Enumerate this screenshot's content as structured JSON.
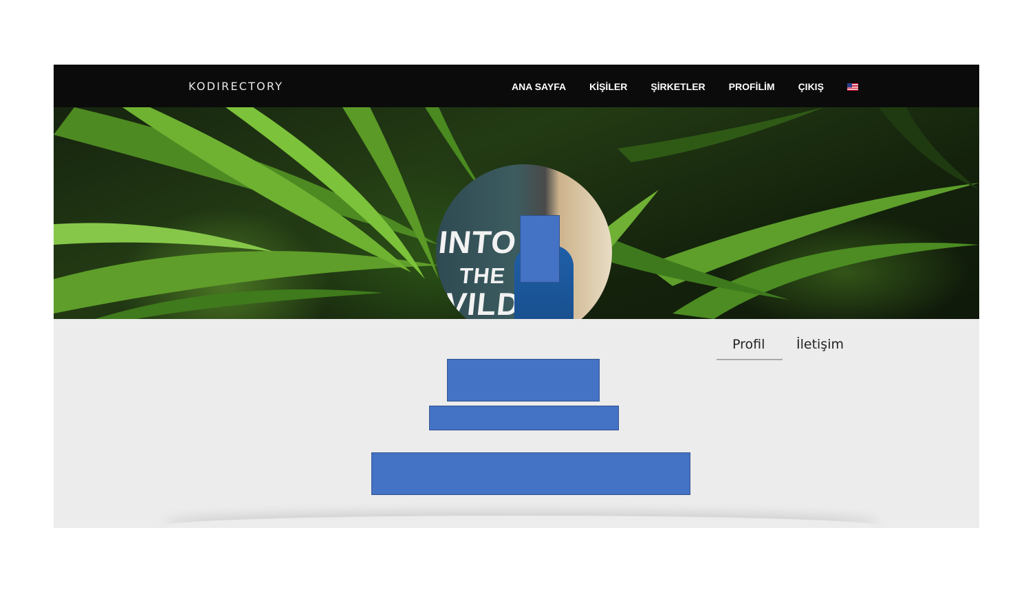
{
  "header": {
    "brand": "KODIRECTORY",
    "nav": [
      {
        "label": "ANA SAYFA"
      },
      {
        "label": "KİŞİLER"
      },
      {
        "label": "ŞİRKETLER"
      },
      {
        "label": "PROFİLİM"
      },
      {
        "label": "ÇIKIŞ"
      }
    ],
    "language_flag": "us-flag-icon"
  },
  "hero": {
    "background": "green plant leaves",
    "avatar": "profile photo"
  },
  "avatar_text": {
    "line1": "INTO",
    "line2": "THE",
    "line3": "VILD"
  },
  "profile": {
    "tabs": [
      {
        "label": "Profil",
        "active": true
      },
      {
        "label": "İletişim",
        "active": false
      }
    ]
  },
  "colors": {
    "navbar": "#0b0b0b",
    "content_bg": "#ececec",
    "redaction": "#4472c4"
  }
}
